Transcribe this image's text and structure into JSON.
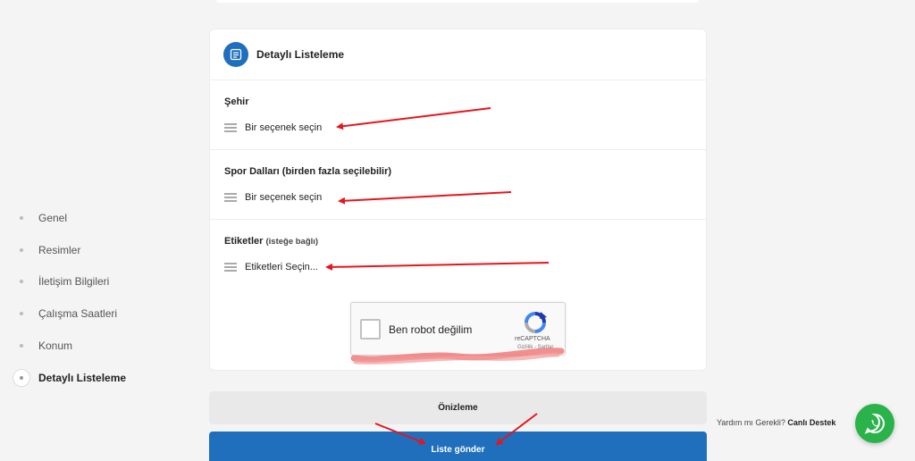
{
  "sidebar": {
    "items": [
      {
        "label": "Genel"
      },
      {
        "label": "Resimler"
      },
      {
        "label": "İletişim Bilgileri"
      },
      {
        "label": "Çalışma Saatleri"
      },
      {
        "label": "Konum"
      },
      {
        "label": "Detaylı Listeleme"
      }
    ]
  },
  "card": {
    "title": "Detaylı Listeleme",
    "fields": [
      {
        "label": "Şehir",
        "optional": "",
        "placeholder": "Bir seçenek seçin"
      },
      {
        "label": "Spor Dalları (birden fazla seçilebilir)",
        "optional": "",
        "placeholder": "Bir seçenek seçin"
      },
      {
        "label": "Etiketler",
        "optional": "(isteğe bağlı)",
        "placeholder": "Etiketleri Seçin..."
      }
    ]
  },
  "captcha": {
    "label": "Ben robot değilim",
    "brand": "reCAPTCHA",
    "links": "Gizlilik - Şartlar"
  },
  "buttons": {
    "preview": "Önizleme",
    "submit": "Liste gönder"
  },
  "support": {
    "question": "Yardım mı Gerekli?",
    "link": "Canlı Destek"
  },
  "colors": {
    "primary": "#1f6fbd",
    "whatsapp": "#29b34a",
    "annotation": "#e8141c"
  }
}
